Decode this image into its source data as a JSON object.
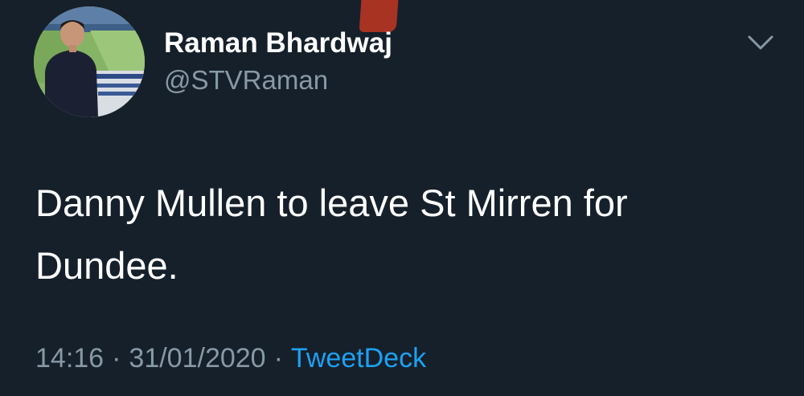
{
  "tweet": {
    "author": {
      "display_name": "Raman Bhardwaj",
      "handle": "@STVRaman"
    },
    "text_line1": "Danny Mullen to leave St Mirren for",
    "text_line2": "Dundee.",
    "time": "14:16",
    "separator": "·",
    "date": "31/01/2020",
    "source": "TweetDeck"
  },
  "icons": {
    "menu": "chevron-down-icon"
  },
  "colors": {
    "background": "#15202b",
    "primary_text": "#ffffff",
    "secondary_text": "#8899a6",
    "link": "#1da1f2"
  }
}
